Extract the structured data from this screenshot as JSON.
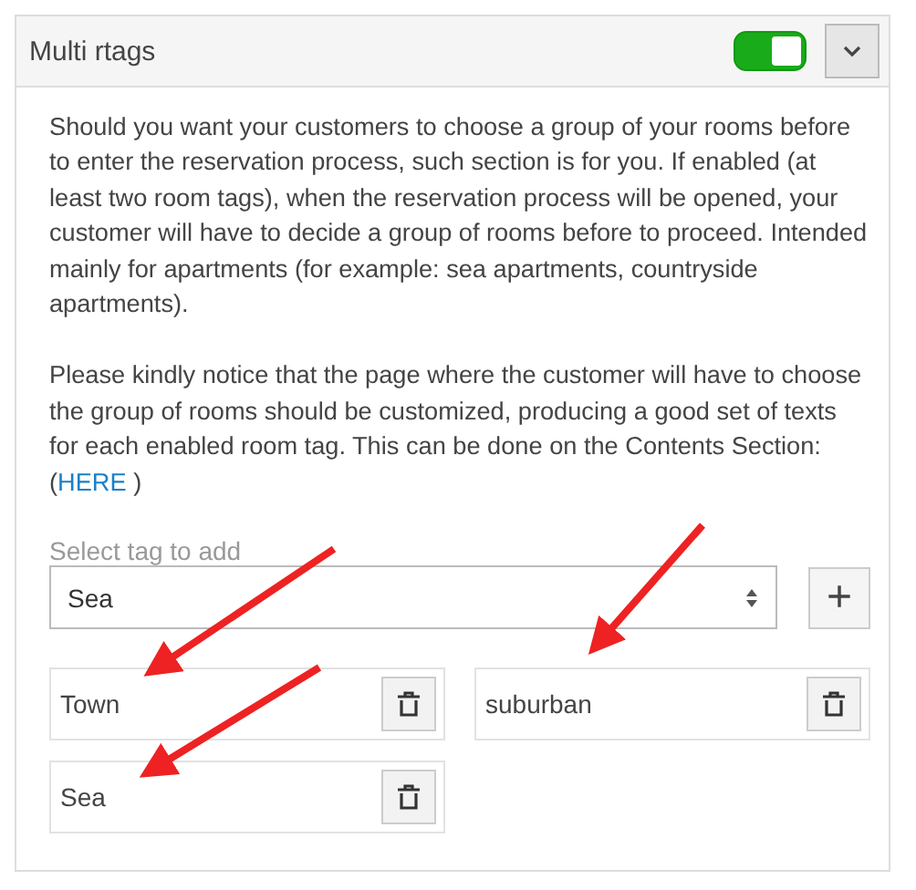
{
  "panel": {
    "title": "Multi rtags",
    "toggle": {
      "on": true
    },
    "expanded": true
  },
  "paragraphs": [
    {
      "text": "Should you want your customers to choose a group of your rooms before to enter the reservation process, such section is for you. If enabled (at least two room tags), when the reservation process will be opened, your customer will have to decide a group of rooms before to proceed. Intended mainly for apartments (for example: sea apartments, countryside apartments)."
    },
    {
      "text": "Please kindly notice that the page where the customer will have to choose the group of rooms should be customized, producing a good set of texts for each enabled room tag. This can be done on the Contents Section: (",
      "link": "HERE",
      "after": ")"
    }
  ],
  "select": {
    "label": "Select tag to add",
    "value": "Sea",
    "add_button": "+"
  },
  "tags": [
    {
      "name": "Town"
    },
    {
      "name": "suburban"
    },
    {
      "name": "Sea"
    }
  ]
}
